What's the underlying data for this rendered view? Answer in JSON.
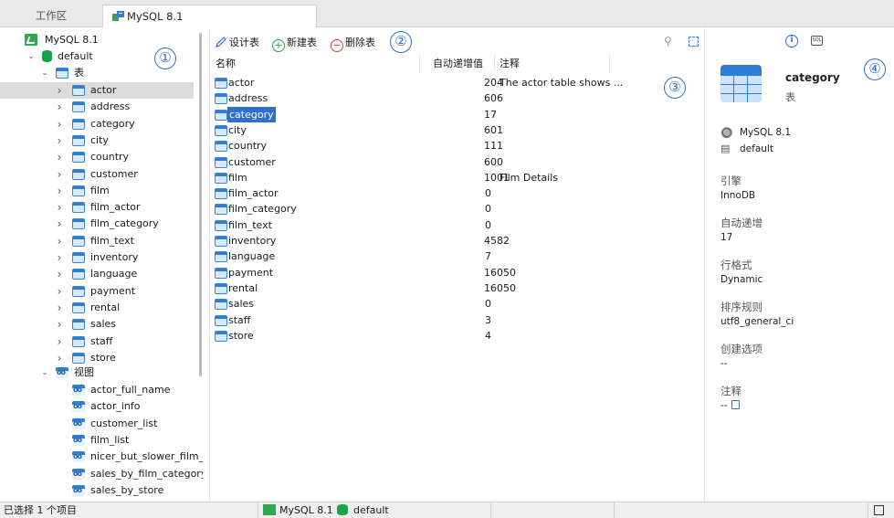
{
  "tabs": {
    "workspace": "工作区",
    "connection": "MySQL 8.1"
  },
  "tree": {
    "connection": "MySQL 8.1",
    "database": "default",
    "tables_group": "表",
    "tables": [
      "actor",
      "address",
      "category",
      "city",
      "country",
      "customer",
      "film",
      "film_actor",
      "film_category",
      "film_text",
      "inventory",
      "language",
      "payment",
      "rental",
      "sales",
      "staff",
      "store"
    ],
    "views_group": "视图",
    "views": [
      "actor_full_name",
      "actor_info",
      "customer_list",
      "film_list",
      "nicer_but_slower_film_li",
      "sales_by_film_category",
      "sales_by_store"
    ],
    "selected": "actor"
  },
  "callouts": [
    "①",
    "②",
    "③",
    "④"
  ],
  "toolbar": {
    "design": "设计表",
    "new": "新建表",
    "delete": "删除表"
  },
  "grid": {
    "headers": {
      "name": "名称",
      "auto_increment": "自动递增值",
      "comment": "注释"
    },
    "rows": [
      {
        "name": "actor",
        "auto": "204",
        "comment": "The actor table shows ..."
      },
      {
        "name": "address",
        "auto": "606",
        "comment": ""
      },
      {
        "name": "category",
        "auto": "17",
        "comment": ""
      },
      {
        "name": "city",
        "auto": "601",
        "comment": ""
      },
      {
        "name": "country",
        "auto": "111",
        "comment": ""
      },
      {
        "name": "customer",
        "auto": "600",
        "comment": ""
      },
      {
        "name": "film",
        "auto": "1001",
        "comment": "Film Details"
      },
      {
        "name": "film_actor",
        "auto": "0",
        "comment": ""
      },
      {
        "name": "film_category",
        "auto": "0",
        "comment": ""
      },
      {
        "name": "film_text",
        "auto": "0",
        "comment": ""
      },
      {
        "name": "inventory",
        "auto": "4582",
        "comment": ""
      },
      {
        "name": "language",
        "auto": "7",
        "comment": ""
      },
      {
        "name": "payment",
        "auto": "16050",
        "comment": ""
      },
      {
        "name": "rental",
        "auto": "16050",
        "comment": ""
      },
      {
        "name": "sales",
        "auto": "0",
        "comment": ""
      },
      {
        "name": "staff",
        "auto": "3",
        "comment": ""
      },
      {
        "name": "store",
        "auto": "4",
        "comment": ""
      }
    ],
    "selected": "category"
  },
  "details": {
    "name": "category",
    "type": "表",
    "connection": "MySQL 8.1",
    "database": "default",
    "engine_label": "引擎",
    "engine": "InnoDB",
    "auto_label": "自动递增",
    "auto": "17",
    "row_format_label": "行格式",
    "row_format": "Dynamic",
    "collation_label": "排序规则",
    "collation": "utf8_general_ci",
    "create_options_label": "创建选项",
    "create_options": "--",
    "comment_label": "注释",
    "comment": "--",
    "sql_tab": "SQL"
  },
  "status": {
    "selection": "已选择 1 个项目",
    "connection": "MySQL 8.1",
    "database": "default"
  },
  "colors": {
    "accent": "#2f6fd1",
    "selection": "#2f6fd1",
    "tree_selection": "#dcdcdc",
    "db_green": "#1aa34a"
  }
}
